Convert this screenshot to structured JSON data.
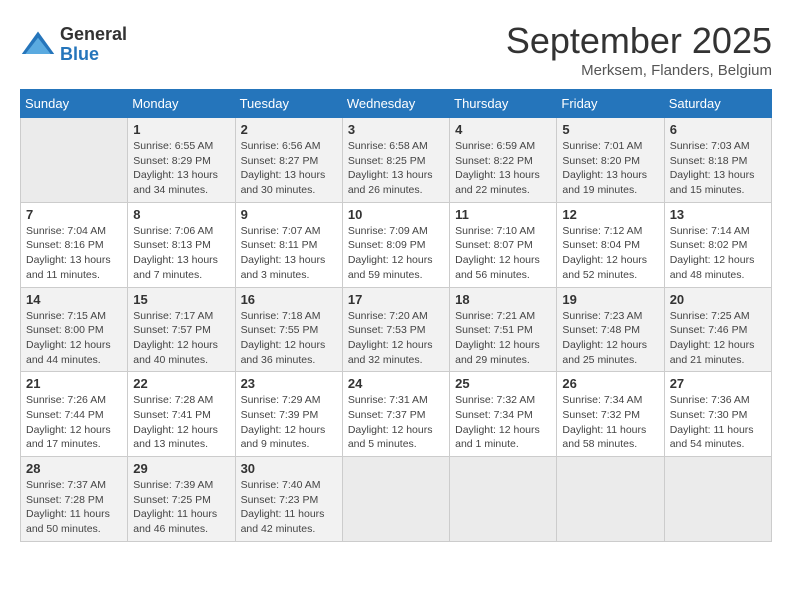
{
  "logo": {
    "general": "General",
    "blue": "Blue"
  },
  "title": "September 2025",
  "subtitle": "Merksem, Flanders, Belgium",
  "days_of_week": [
    "Sunday",
    "Monday",
    "Tuesday",
    "Wednesday",
    "Thursday",
    "Friday",
    "Saturday"
  ],
  "weeks": [
    [
      {
        "day": "",
        "sunrise": "",
        "sunset": "",
        "daylight": "",
        "empty": true
      },
      {
        "day": "1",
        "sunrise": "Sunrise: 6:55 AM",
        "sunset": "Sunset: 8:29 PM",
        "daylight": "Daylight: 13 hours and 34 minutes."
      },
      {
        "day": "2",
        "sunrise": "Sunrise: 6:56 AM",
        "sunset": "Sunset: 8:27 PM",
        "daylight": "Daylight: 13 hours and 30 minutes."
      },
      {
        "day": "3",
        "sunrise": "Sunrise: 6:58 AM",
        "sunset": "Sunset: 8:25 PM",
        "daylight": "Daylight: 13 hours and 26 minutes."
      },
      {
        "day": "4",
        "sunrise": "Sunrise: 6:59 AM",
        "sunset": "Sunset: 8:22 PM",
        "daylight": "Daylight: 13 hours and 22 minutes."
      },
      {
        "day": "5",
        "sunrise": "Sunrise: 7:01 AM",
        "sunset": "Sunset: 8:20 PM",
        "daylight": "Daylight: 13 hours and 19 minutes."
      },
      {
        "day": "6",
        "sunrise": "Sunrise: 7:03 AM",
        "sunset": "Sunset: 8:18 PM",
        "daylight": "Daylight: 13 hours and 15 minutes."
      }
    ],
    [
      {
        "day": "7",
        "sunrise": "Sunrise: 7:04 AM",
        "sunset": "Sunset: 8:16 PM",
        "daylight": "Daylight: 13 hours and 11 minutes."
      },
      {
        "day": "8",
        "sunrise": "Sunrise: 7:06 AM",
        "sunset": "Sunset: 8:13 PM",
        "daylight": "Daylight: 13 hours and 7 minutes."
      },
      {
        "day": "9",
        "sunrise": "Sunrise: 7:07 AM",
        "sunset": "Sunset: 8:11 PM",
        "daylight": "Daylight: 13 hours and 3 minutes."
      },
      {
        "day": "10",
        "sunrise": "Sunrise: 7:09 AM",
        "sunset": "Sunset: 8:09 PM",
        "daylight": "Daylight: 12 hours and 59 minutes."
      },
      {
        "day": "11",
        "sunrise": "Sunrise: 7:10 AM",
        "sunset": "Sunset: 8:07 PM",
        "daylight": "Daylight: 12 hours and 56 minutes."
      },
      {
        "day": "12",
        "sunrise": "Sunrise: 7:12 AM",
        "sunset": "Sunset: 8:04 PM",
        "daylight": "Daylight: 12 hours and 52 minutes."
      },
      {
        "day": "13",
        "sunrise": "Sunrise: 7:14 AM",
        "sunset": "Sunset: 8:02 PM",
        "daylight": "Daylight: 12 hours and 48 minutes."
      }
    ],
    [
      {
        "day": "14",
        "sunrise": "Sunrise: 7:15 AM",
        "sunset": "Sunset: 8:00 PM",
        "daylight": "Daylight: 12 hours and 44 minutes."
      },
      {
        "day": "15",
        "sunrise": "Sunrise: 7:17 AM",
        "sunset": "Sunset: 7:57 PM",
        "daylight": "Daylight: 12 hours and 40 minutes."
      },
      {
        "day": "16",
        "sunrise": "Sunrise: 7:18 AM",
        "sunset": "Sunset: 7:55 PM",
        "daylight": "Daylight: 12 hours and 36 minutes."
      },
      {
        "day": "17",
        "sunrise": "Sunrise: 7:20 AM",
        "sunset": "Sunset: 7:53 PM",
        "daylight": "Daylight: 12 hours and 32 minutes."
      },
      {
        "day": "18",
        "sunrise": "Sunrise: 7:21 AM",
        "sunset": "Sunset: 7:51 PM",
        "daylight": "Daylight: 12 hours and 29 minutes."
      },
      {
        "day": "19",
        "sunrise": "Sunrise: 7:23 AM",
        "sunset": "Sunset: 7:48 PM",
        "daylight": "Daylight: 12 hours and 25 minutes."
      },
      {
        "day": "20",
        "sunrise": "Sunrise: 7:25 AM",
        "sunset": "Sunset: 7:46 PM",
        "daylight": "Daylight: 12 hours and 21 minutes."
      }
    ],
    [
      {
        "day": "21",
        "sunrise": "Sunrise: 7:26 AM",
        "sunset": "Sunset: 7:44 PM",
        "daylight": "Daylight: 12 hours and 17 minutes."
      },
      {
        "day": "22",
        "sunrise": "Sunrise: 7:28 AM",
        "sunset": "Sunset: 7:41 PM",
        "daylight": "Daylight: 12 hours and 13 minutes."
      },
      {
        "day": "23",
        "sunrise": "Sunrise: 7:29 AM",
        "sunset": "Sunset: 7:39 PM",
        "daylight": "Daylight: 12 hours and 9 minutes."
      },
      {
        "day": "24",
        "sunrise": "Sunrise: 7:31 AM",
        "sunset": "Sunset: 7:37 PM",
        "daylight": "Daylight: 12 hours and 5 minutes."
      },
      {
        "day": "25",
        "sunrise": "Sunrise: 7:32 AM",
        "sunset": "Sunset: 7:34 PM",
        "daylight": "Daylight: 12 hours and 1 minute."
      },
      {
        "day": "26",
        "sunrise": "Sunrise: 7:34 AM",
        "sunset": "Sunset: 7:32 PM",
        "daylight": "Daylight: 11 hours and 58 minutes."
      },
      {
        "day": "27",
        "sunrise": "Sunrise: 7:36 AM",
        "sunset": "Sunset: 7:30 PM",
        "daylight": "Daylight: 11 hours and 54 minutes."
      }
    ],
    [
      {
        "day": "28",
        "sunrise": "Sunrise: 7:37 AM",
        "sunset": "Sunset: 7:28 PM",
        "daylight": "Daylight: 11 hours and 50 minutes."
      },
      {
        "day": "29",
        "sunrise": "Sunrise: 7:39 AM",
        "sunset": "Sunset: 7:25 PM",
        "daylight": "Daylight: 11 hours and 46 minutes."
      },
      {
        "day": "30",
        "sunrise": "Sunrise: 7:40 AM",
        "sunset": "Sunset: 7:23 PM",
        "daylight": "Daylight: 11 hours and 42 minutes."
      },
      {
        "day": "",
        "sunrise": "",
        "sunset": "",
        "daylight": "",
        "empty": true
      },
      {
        "day": "",
        "sunrise": "",
        "sunset": "",
        "daylight": "",
        "empty": true
      },
      {
        "day": "",
        "sunrise": "",
        "sunset": "",
        "daylight": "",
        "empty": true
      },
      {
        "day": "",
        "sunrise": "",
        "sunset": "",
        "daylight": "",
        "empty": true
      }
    ]
  ]
}
